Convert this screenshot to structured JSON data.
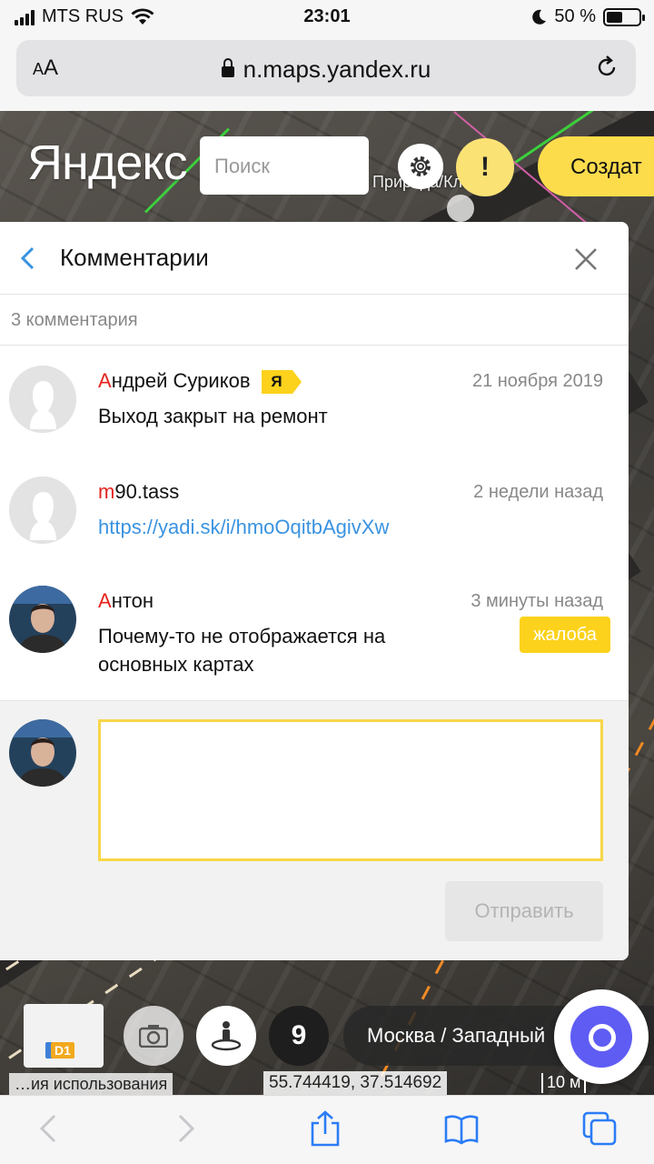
{
  "status_bar": {
    "carrier": "MTS RUS",
    "time": "23:01",
    "battery": "50 %",
    "battery_level": 0.5
  },
  "browser": {
    "text_size_label_small": "A",
    "text_size_label_large": "A",
    "url": "n.maps.yandex.ru"
  },
  "map_header": {
    "logo": "Яндекс",
    "search_placeholder": "Поиск",
    "alert_label": "!",
    "create_label": "Создат",
    "map_label": "Природа/Класс"
  },
  "comments_panel": {
    "title": "Комментарии",
    "count_text": "3 комментария",
    "comments": [
      {
        "author_first": "А",
        "author_rest": "ндрей Суриков",
        "badge": "Я",
        "date": "21 ноября 2019",
        "text": "Выход закрыт на ремонт"
      },
      {
        "author_first": "m",
        "author_rest": "90.tass",
        "date": "2 недели назад",
        "text": "https://yadi.sk/i/hmoOqitbAgivXw"
      },
      {
        "author_first": "А",
        "author_rest": "нтон",
        "date": "3 минуты назад",
        "text": "Почему-то не отображается на основных картах",
        "report_label": "жалоба"
      }
    ],
    "composer": {
      "text_value": "",
      "send_label": "Отправить"
    }
  },
  "map_controls": {
    "minimap_badge": "D1",
    "pano_label": "9",
    "location_text": "Москва / Западный",
    "terms_text": "…ия использования",
    "coordinates": "55.744419, 37.514692",
    "scale_text": "10 м"
  },
  "colors": {
    "accent_yellow": "#fcd21c",
    "author_red": "#e5241e",
    "link_blue": "#3a93e0",
    "alice_purple": "#5f5cf4"
  }
}
